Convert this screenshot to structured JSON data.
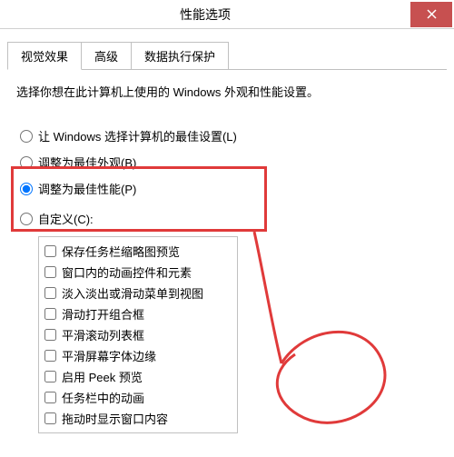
{
  "window": {
    "title": "性能选项"
  },
  "tabs": {
    "visual": "视觉效果",
    "advanced": "高级",
    "dep": "数据执行保护"
  },
  "description": "选择你想在此计算机上使用的 Windows 外观和性能设置。",
  "radios": {
    "best_auto": "让 Windows 选择计算机的最佳设置(L)",
    "best_appearance": "调整为最佳外观(B)",
    "best_performance": "调整为最佳性能(P)",
    "custom": "自定义(C):"
  },
  "checkboxes": [
    "保存任务栏缩略图预览",
    "窗口内的动画控件和元素",
    "淡入淡出或滑动菜单到视图",
    "滑动打开组合框",
    "平滑滚动列表框",
    "平滑屏幕字体边缘",
    "启用 Peek 预览",
    "任务栏中的动画",
    "拖动时显示窗口内容"
  ],
  "colors": {
    "close_bg": "#c75050",
    "annotation": "#e03a3a"
  }
}
